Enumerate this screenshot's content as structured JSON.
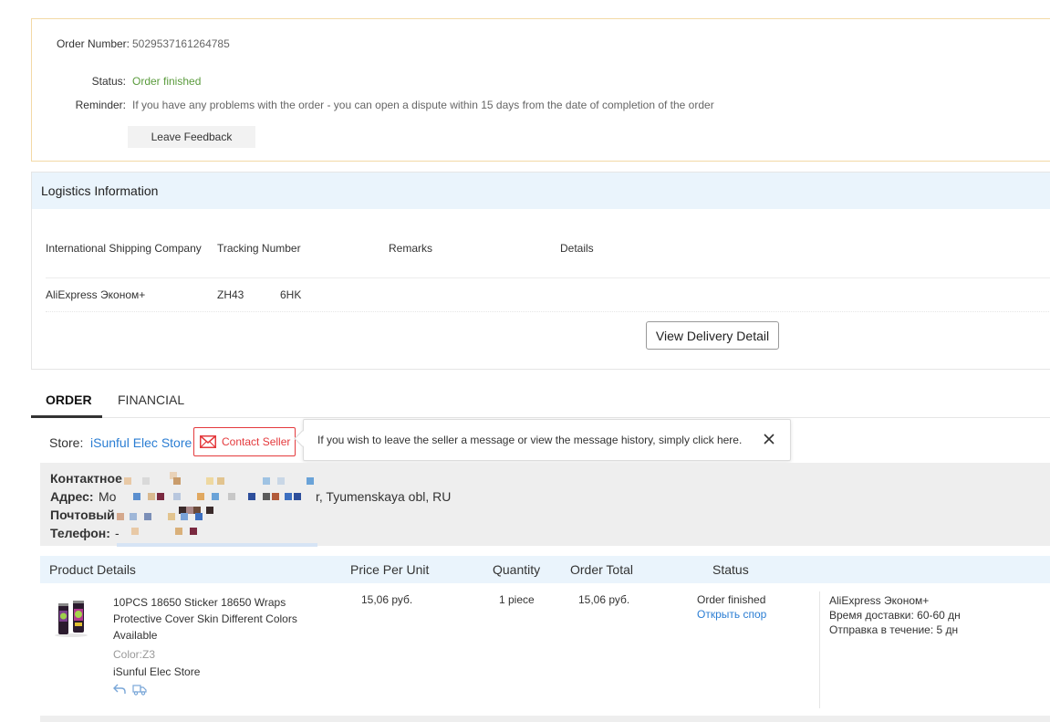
{
  "order_info": {
    "order_number_label": "Order Number:",
    "order_number": "5029537161264785",
    "status_label": "Status:",
    "status": "Order finished",
    "reminder_label": "Reminder:",
    "reminder": "If you have any problems with the order - you can open a dispute within 15 days from the date of completion of the order",
    "leave_feedback": "Leave Feedback"
  },
  "logistics": {
    "title": "Logistics Information",
    "columns": [
      "International Shipping Company",
      "Tracking Number",
      "Remarks",
      "Details"
    ],
    "row": {
      "company": "AliExpress Эконом+",
      "tracking_part1": "ZH43",
      "tracking_part2": "6HK"
    },
    "view_delivery": "View Delivery Detail"
  },
  "tabs": [
    "ORDER",
    "FINANCIAL"
  ],
  "store": {
    "label": "Store:",
    "name": "iSunful Elec Store",
    "contact_seller": "Contact Seller"
  },
  "tooltip": {
    "text": "If you wish to leave the seller a message or view the message history, simply click here."
  },
  "address": {
    "contact_label": "Контактное",
    "address_label": "Адрес:",
    "address_prefix": "Mo",
    "address_suffix": "r, Tyumenskaya obl, RU",
    "postal_label": "Почтовый",
    "phone_label": "Телефон:",
    "phone_prefix": "-"
  },
  "table": {
    "headers": [
      "Product Details",
      "Price Per Unit",
      "Quantity",
      "Order Total",
      "Status"
    ],
    "product": {
      "title_line1": "10PCS 18650 Sticker 18650 Wraps",
      "title_line2": "Protective Cover Skin Different Colors",
      "title_line3": "Available",
      "color": "Color:Z3",
      "store": "iSunful Elec Store",
      "price": "15,06 руб.",
      "quantity": "1 piece",
      "total": "15,06 руб.",
      "status": "Order finished",
      "dispute_link": "Открыть спор",
      "shipping_method": "AliExpress Эконом+",
      "delivery_time": "Время доставки: 60-60 дн",
      "dispatch_time": "Отправка в течение: 5 дн"
    }
  },
  "colors": {
    "accent_red": "#e43a3d",
    "link_blue": "#2a7dd3",
    "status_green": "#5a9b3c",
    "header_blue": "#eaf4fc"
  }
}
